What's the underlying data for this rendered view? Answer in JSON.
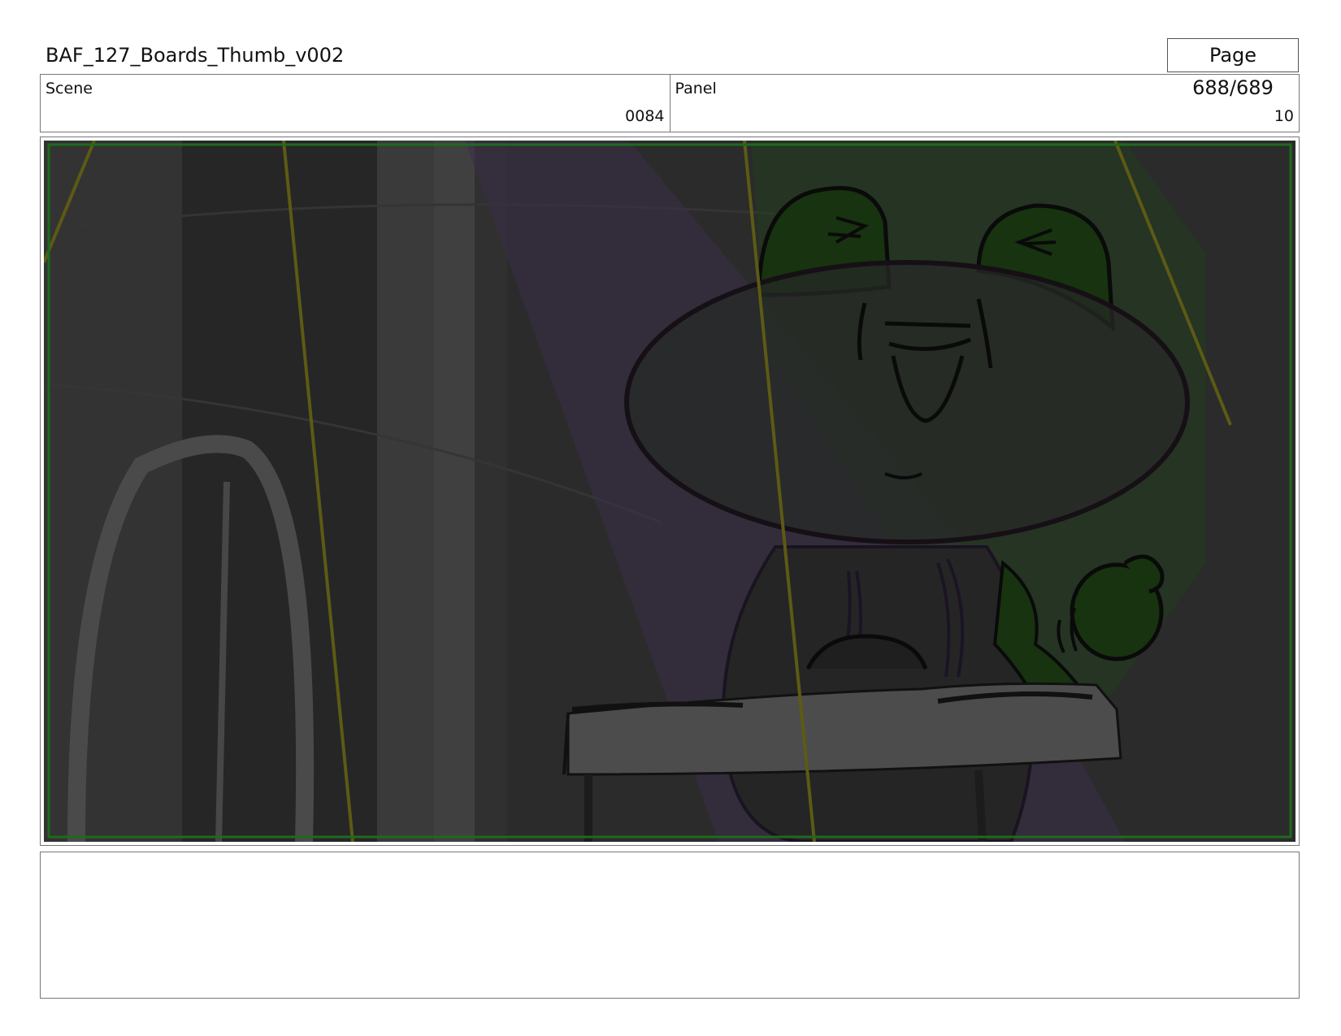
{
  "header": {
    "title": "BAF_127_Boards_Thumb_v002",
    "page": "Page 688/689"
  },
  "info": {
    "scene_label": "Scene",
    "scene_value": "0084",
    "panel_label": "Panel",
    "panel_value": "10"
  },
  "notes": {
    "text": ""
  },
  "colors": {
    "frame_background": "#2b2b2b",
    "safe_area_green": "#1e6a1e",
    "character_green": "#17330f",
    "purple_light": "#3a2d48"
  }
}
